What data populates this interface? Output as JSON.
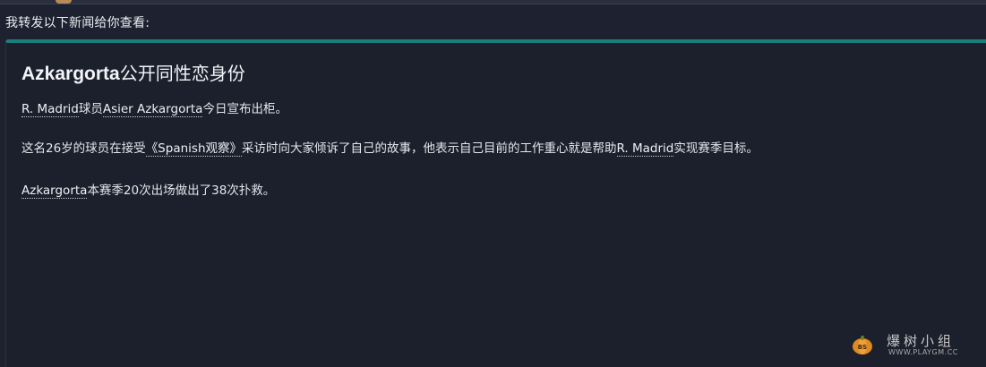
{
  "intro": "我转发以下新闻给你查看:",
  "article": {
    "headline_name": "Azkargorta",
    "headline_rest": "公开同性恋身份",
    "p1": {
      "club": "R. Madrid",
      "t1": "球员",
      "player": "Asier Azkargorta",
      "t2": "今日宣布出柜。"
    },
    "p2": {
      "t1": "这名26岁的球员在接受",
      "media": "《Spanish观察》",
      "t2": "采访时向大家倾诉了自己的故事，他表示自己目前的工作重心就是帮助",
      "club": "R. Madrid",
      "t3": "实现赛季目标。"
    },
    "p3": {
      "player": "Azkargorta",
      "t1": "本赛季20次出场做出了38次扑救。"
    }
  },
  "watermark": {
    "text": "爆树小组",
    "url": "WWW.PLAYGM.CC",
    "icon": "pumpkin-logo-icon"
  },
  "colors": {
    "background": "#1e2230",
    "card": "#1c202c",
    "accent": "#1a7f7a"
  }
}
